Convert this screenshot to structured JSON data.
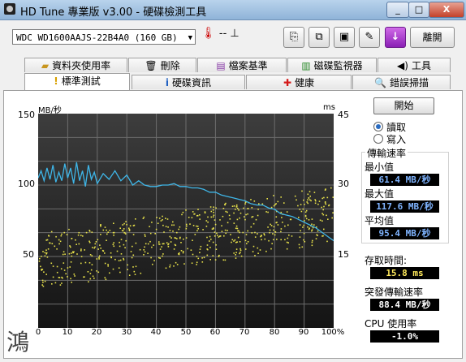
{
  "window": {
    "title": "HD Tune 專業版 v3.00 - 硬碟檢測工具",
    "minimize": "_",
    "maximize": "□",
    "close": "X"
  },
  "toolbar": {
    "drive": "WDC WD1600AAJS-22B4A0 (160 GB)",
    "temperature": "-- ⊥",
    "exit_label": "離開",
    "buttons": [
      {
        "icon": "copy-text-icon"
      },
      {
        "icon": "copy-screenshot-icon"
      },
      {
        "icon": "save-icon"
      },
      {
        "icon": "options-icon"
      },
      {
        "icon": "download-icon"
      }
    ]
  },
  "tabs_top": [
    "資料夾使用率",
    "刪除",
    "檔案基準",
    "磁碟監視器",
    "工具"
  ],
  "tabs_bottom": [
    "標準測試",
    "硬碟資訊",
    "健康",
    "錯誤掃描"
  ],
  "active_tab": "標準測試",
  "controls": {
    "start_label": "開始",
    "read_label": "讀取",
    "write_label": "寫入",
    "mode_selected": "讀取"
  },
  "results": {
    "transfer_title": "傳輸速率",
    "min_label": "最小值",
    "min_value": "61.4 MB/秒",
    "max_label": "最大值",
    "max_value": "117.6 MB/秒",
    "avg_label": "平均值",
    "avg_value": "95.4 MB/秒",
    "access_label": "存取時間:",
    "access_value": "15.8 ms",
    "burst_label": "突發傳輸速率",
    "burst_value": "88.4 MB/秒",
    "cpu_label": "CPU 使用率",
    "cpu_value": "-1.0%"
  },
  "chart_data": {
    "type": "line",
    "left_axis_label": "MB/秒",
    "right_axis_label": "ms",
    "y_left_ticks": [
      "150",
      "100",
      "50"
    ],
    "y_right_ticks": [
      "45",
      "30",
      "15"
    ],
    "x_ticks": [
      "0",
      "10",
      "20",
      "30",
      "40",
      "50",
      "60",
      "70",
      "80",
      "90",
      "100%"
    ],
    "xlim": [
      0,
      100
    ],
    "ylim_left": [
      0,
      150
    ],
    "ylim_right": [
      0,
      45
    ],
    "grid": true,
    "series": [
      {
        "color": "#3fb6e8",
        "x": [
          0,
          1,
          2,
          3,
          4,
          5,
          6,
          7,
          8,
          9,
          10,
          11,
          12,
          13,
          14,
          15,
          16,
          17,
          18,
          19,
          20,
          22,
          24,
          26,
          28,
          30,
          32,
          34,
          36,
          38,
          40,
          42,
          44,
          46,
          48,
          50,
          52,
          54,
          56,
          58,
          60,
          62,
          64,
          66,
          68,
          70,
          72,
          74,
          76,
          78,
          80,
          82,
          84,
          86,
          88,
          90,
          92,
          94,
          96,
          98,
          100
        ],
        "y": [
          105,
          110,
          103,
          112,
          104,
          114,
          102,
          109,
          103,
          115,
          105,
          112,
          101,
          116,
          103,
          110,
          99,
          114,
          104,
          109,
          101,
          108,
          104,
          110,
          103,
          107,
          100,
          103,
          100,
          99,
          99,
          100,
          100,
          101,
          99,
          99,
          98,
          98,
          97,
          95,
          95,
          93,
          92,
          91,
          90,
          89,
          87,
          86,
          86,
          84,
          83,
          80,
          79,
          78,
          76,
          74,
          72,
          70,
          67,
          64,
          61
        ]
      }
    ],
    "access_scatter": {
      "color": "#e8e24a",
      "description_unit": "ms",
      "range_at_start": [
        8,
        20
      ],
      "range_at_end": [
        18,
        30
      ]
    }
  }
}
